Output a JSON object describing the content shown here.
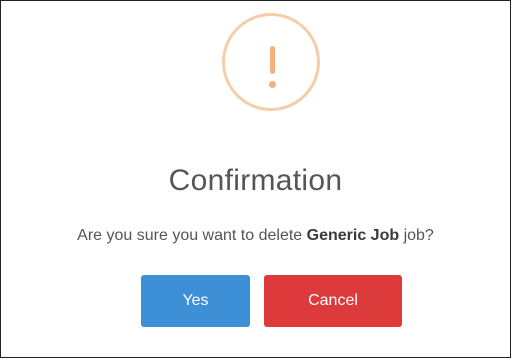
{
  "dialog": {
    "icon": "exclamation-warning-icon",
    "title": "Confirmation",
    "message_before": "Are you sure you want to delete",
    "item_name": "Generic Job",
    "message_after": "job?",
    "yes_label": "Yes",
    "cancel_label": "Cancel"
  },
  "colors": {
    "icon_ring": "#f7cca6",
    "icon_mark": "#f5b07d",
    "confirm_button": "#3d8fd6",
    "cancel_button": "#dd3b3b",
    "text": "#555555"
  }
}
